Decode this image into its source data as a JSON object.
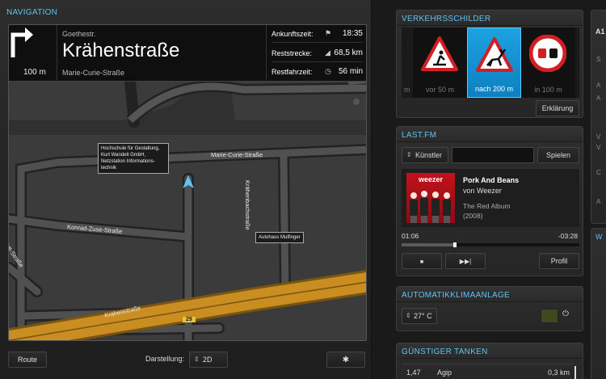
{
  "navigation": {
    "title": "NAVIGATION",
    "turn_distance": "100 m",
    "from_street": "Goethestr.",
    "current_street": "Krähenstraße",
    "next_street": "Marie-Curie-Straße",
    "arrival_label": "Ankunftszeit:",
    "arrival_value": "18:35",
    "remaining_distance_label": "Reststrecke:",
    "remaining_distance_value": "68,5 km",
    "remaining_time_label": "Restfahrzeit:",
    "remaining_time_value": "56 min",
    "map_labels": {
      "marie_curie": "Marie-Curie-Straße",
      "kraehenbach": "Krähenbachstraße",
      "konrad_zuse": "Konrad-Zuse-Straße",
      "kraehen": "Krähenstraße",
      "boldt": "Boldt-Straße",
      "road_number": "29"
    },
    "poi_hochschule": [
      "Hochschule für Gestaltung,",
      "Kurt Wandelt GmbH,",
      "Netzstation Informations-",
      "technik"
    ],
    "poi_autohaus": "Autohaus Mulfinger",
    "route_button": "Route",
    "display_label": "Darstellung:",
    "display_value": "2D"
  },
  "traffic_signs": {
    "title": "VERKEHRSSCHILDER",
    "left_partial_label": "m",
    "items": [
      {
        "label": "vor 50 m",
        "sign": "roadworks-sign-icon"
      },
      {
        "label": "nach 200 m",
        "sign": "deer-crossing-sign-icon",
        "active": true
      },
      {
        "label": "in 100 m",
        "sign": "no-overtaking-sign-icon"
      }
    ],
    "explain_button": "Erklärung"
  },
  "lastfm": {
    "title": "LAST.FM",
    "mode_value": "Künstler",
    "search_value": "",
    "play_button": "Spielen",
    "album_brand": "weezer",
    "track_title": "Pork And Beans",
    "track_artist": "von Weezer",
    "album": "The Red Album",
    "year": "(2008)",
    "time_elapsed": "01:06",
    "time_remaining": "-03:28",
    "progress_fraction": 0.29,
    "profile_button": "Profil"
  },
  "climate": {
    "title": "AUTOMATIKKLIMAANLAGE",
    "temperature": "27° C"
  },
  "fuel": {
    "title": "GÜNSTIGER TANKEN",
    "rows": [
      {
        "price": "1,47",
        "station": "Agip",
        "distance": "0,3 km"
      }
    ]
  },
  "right_edge": {
    "labels": [
      "A1",
      "S",
      "A",
      "A",
      "V",
      "V",
      "C",
      "A",
      "W"
    ]
  },
  "colors": {
    "accent": "#5fc3f0",
    "highway": "#c98d22",
    "active_sign": "#1592d5"
  }
}
